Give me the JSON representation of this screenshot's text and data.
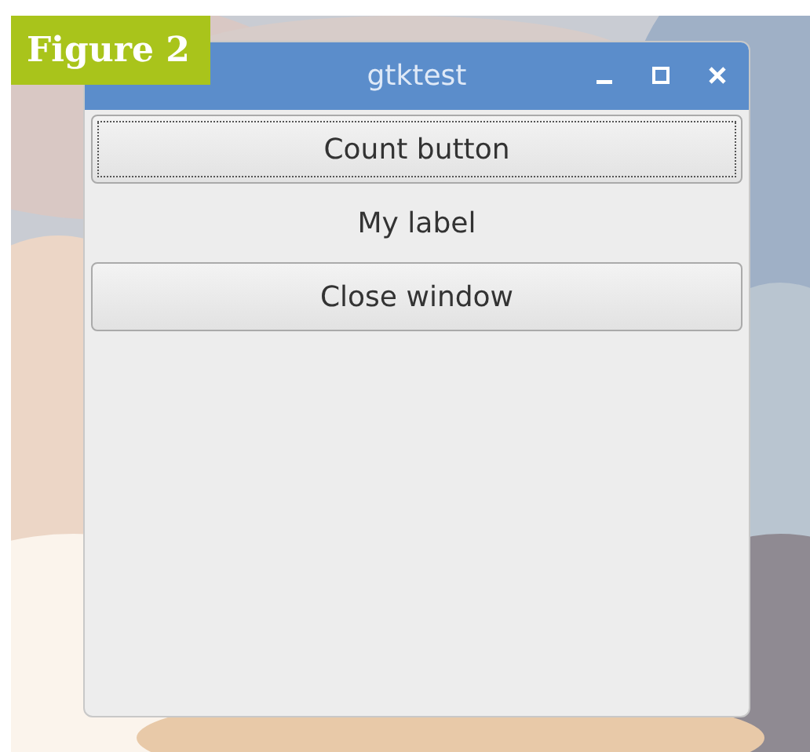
{
  "figure_label": "Figure 2",
  "window": {
    "title": "gtktest",
    "widgets": [
      {
        "kind": "button",
        "text": "Count button",
        "focused": true
      },
      {
        "kind": "label",
        "text": "My label"
      },
      {
        "kind": "button",
        "text": "Close window",
        "focused": false
      }
    ]
  }
}
